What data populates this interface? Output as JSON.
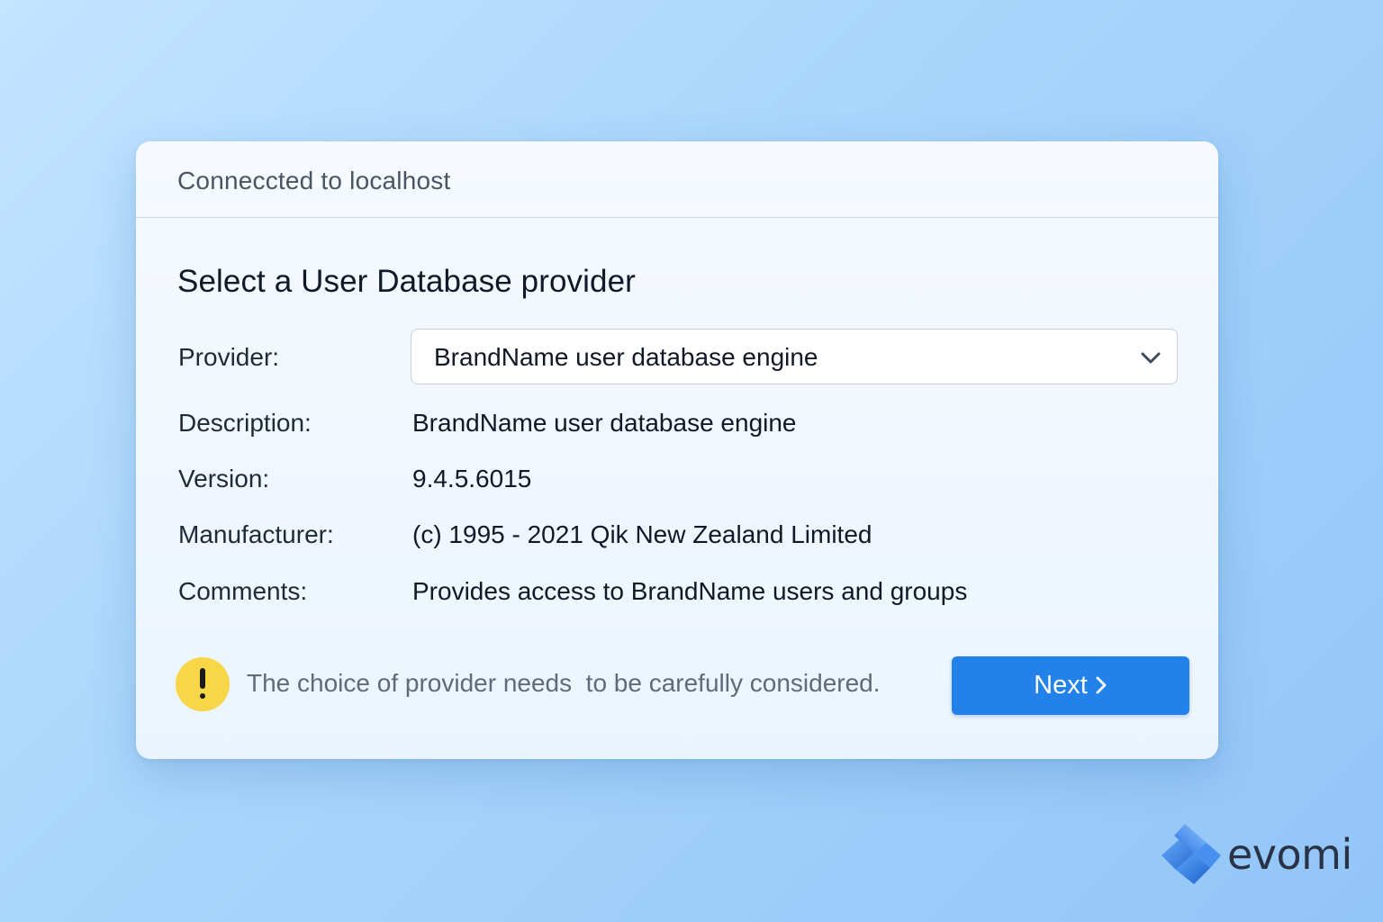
{
  "header": {
    "connection_status": "Connecc­ted to localhost"
  },
  "main": {
    "title": "Select a User Database provider",
    "fields": [
      {
        "label": "Provider:",
        "value": "BrandName user database engine"
      },
      {
        "label": "Description:",
        "value": "BrandName user database engine"
      },
      {
        "label": "Version:",
        "value": "9.4.5.6015"
      },
      {
        "label": "Manufacturer:",
        "value": "(c) 1995 - 2021 Qik New Zealand Limited"
      },
      {
        "label": "Comments:",
        "value": "Provides access to BrandName users and groups"
      }
    ],
    "provider_select": {
      "selected": "BrandName user database engine",
      "icon": "chevron-down-icon"
    }
  },
  "footer": {
    "warning_text": "The choice of provider needs  to be carefully considered.",
    "warning_icon": "exclamation-icon",
    "warning_icon_color": "#f9d648",
    "next_label": "Next",
    "next_icon": "chevron-right-icon",
    "accent_color": "#2382ea"
  },
  "watermark": {
    "brand": "evomi"
  }
}
